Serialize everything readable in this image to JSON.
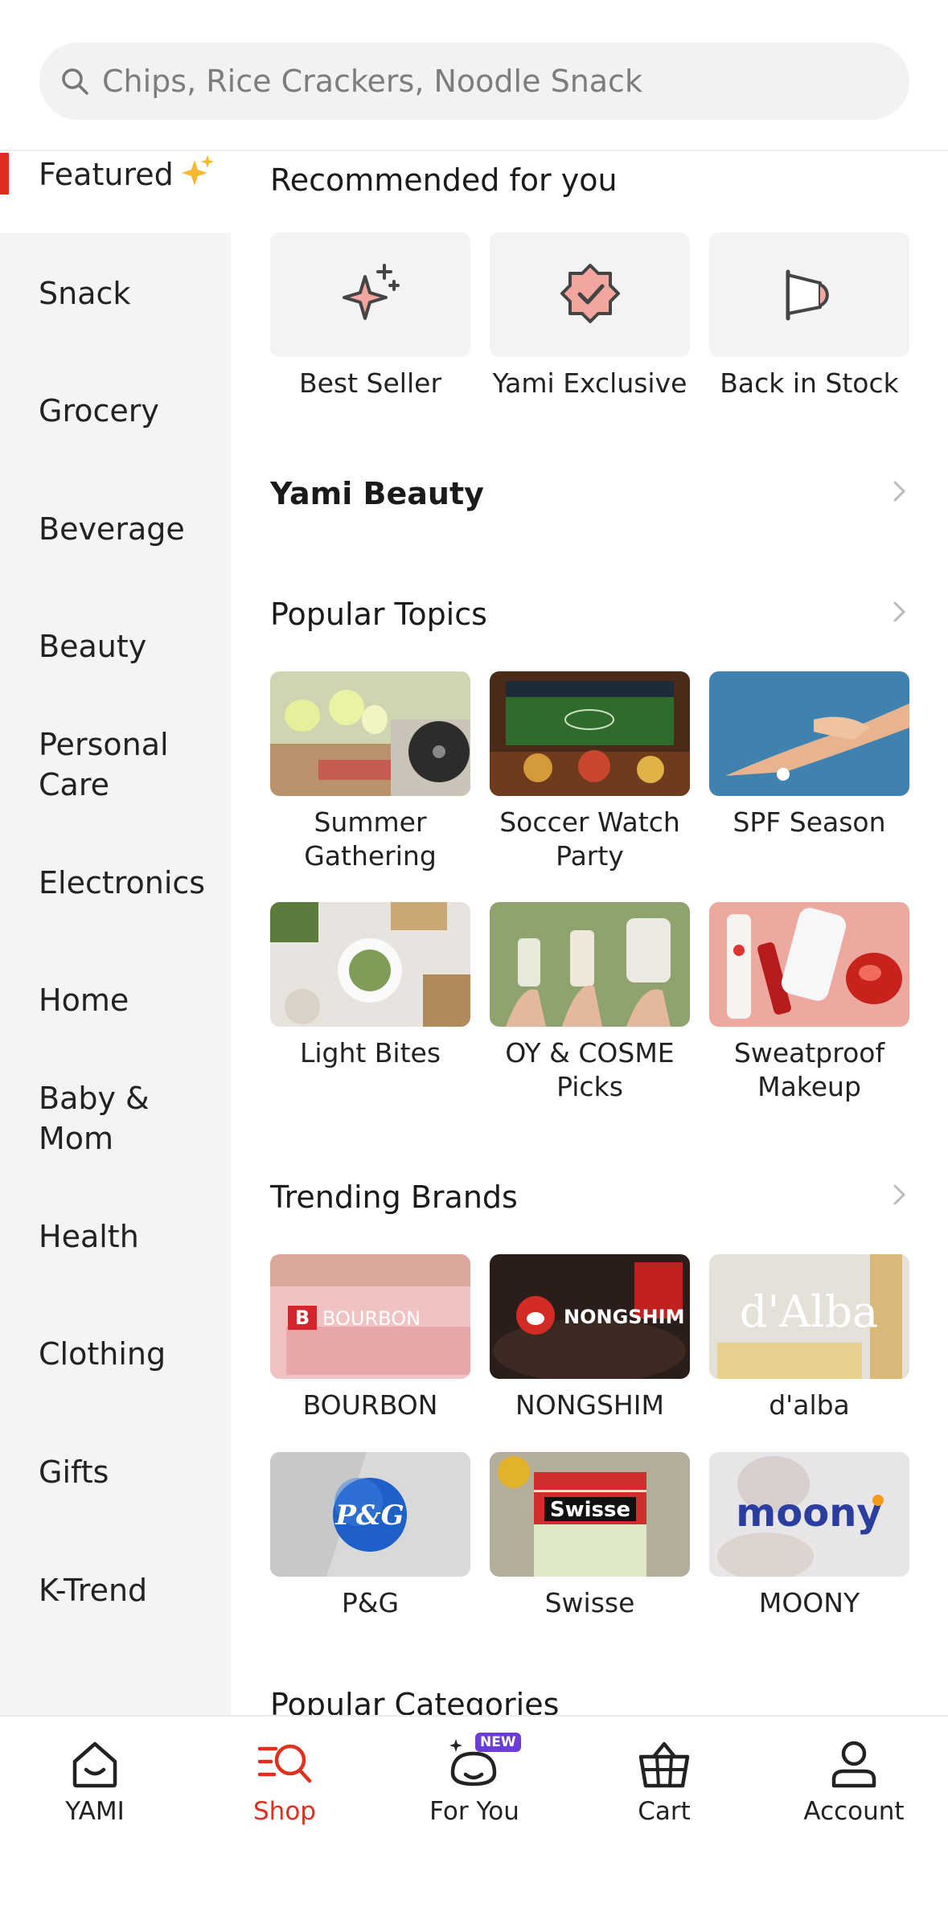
{
  "search": {
    "placeholder": "Chips, Rice Crackers, Noodle Snack"
  },
  "sidebar": {
    "items": [
      {
        "label": "Featured"
      },
      {
        "label": "Snack"
      },
      {
        "label": "Grocery"
      },
      {
        "label": "Beverage"
      },
      {
        "label": "Beauty"
      },
      {
        "label": "Personal Care"
      },
      {
        "label": "Electronics"
      },
      {
        "label": "Home"
      },
      {
        "label": "Baby & Mom"
      },
      {
        "label": "Health"
      },
      {
        "label": "Clothing"
      },
      {
        "label": "Gifts"
      },
      {
        "label": "K-Trend"
      }
    ]
  },
  "main": {
    "recommended_title": "Recommended for you",
    "recommended": [
      {
        "label": "Best Seller",
        "icon": "sparkle-icon"
      },
      {
        "label": "Yami Exclusive",
        "icon": "badge-check-icon"
      },
      {
        "label": "Back in Stock",
        "icon": "megaphone-icon"
      }
    ],
    "beauty_title": "Yami Beauty",
    "topics_title": "Popular Topics",
    "topics": [
      {
        "label": "Summer Gathering"
      },
      {
        "label": "Soccer Watch Party"
      },
      {
        "label": "SPF Season"
      },
      {
        "label": "Light Bites"
      },
      {
        "label": "OY & COSME Picks"
      },
      {
        "label": "Sweatproof Makeup"
      }
    ],
    "brands_title": "Trending Brands",
    "brands": [
      {
        "label": "BOURBON",
        "logo_text": "BOURBON"
      },
      {
        "label": "NONGSHIM",
        "logo_text": "NONGSHIM"
      },
      {
        "label": "d'alba",
        "logo_text": "d'Alba"
      },
      {
        "label": "P&G",
        "logo_text": "P&G"
      },
      {
        "label": "Swisse",
        "logo_text": "Swisse"
      },
      {
        "label": "MOONY",
        "logo_text": "moony"
      }
    ],
    "categories_title": "Popular Categories"
  },
  "tabbar": {
    "tabs": [
      {
        "label": "YAMI",
        "icon": "home-icon"
      },
      {
        "label": "Shop",
        "icon": "shop-search-icon"
      },
      {
        "label": "For You",
        "icon": "foryou-icon",
        "badge": "NEW"
      },
      {
        "label": "Cart",
        "icon": "basket-icon"
      },
      {
        "label": "Account",
        "icon": "person-icon"
      }
    ],
    "active": "Shop"
  },
  "colors": {
    "accent": "#e0301e",
    "sidebar_bg": "#f4f4f4",
    "badge": "#6a3ddb"
  }
}
